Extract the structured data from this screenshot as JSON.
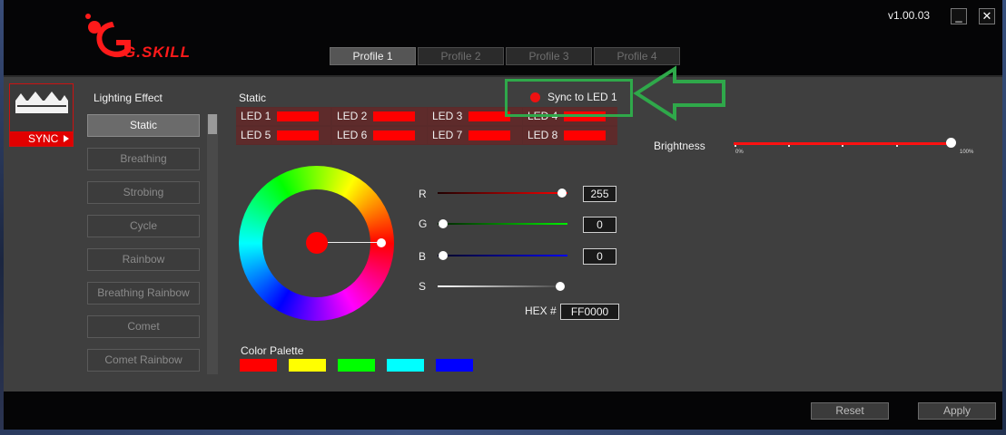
{
  "app": {
    "logo_text": "G.SKILL",
    "version": "v1.00.03",
    "minimize_glyph": "_",
    "close_glyph": "✕"
  },
  "profiles": [
    {
      "label": "Profile 1",
      "active": true
    },
    {
      "label": "Profile 2",
      "active": false
    },
    {
      "label": "Profile 3",
      "active": false
    },
    {
      "label": "Profile 4",
      "active": false
    }
  ],
  "module": {
    "sync_label": "SYNC"
  },
  "lighting": {
    "title": "Lighting Effect",
    "effects": [
      "Static",
      "Breathing",
      "Strobing",
      "Cycle",
      "Rainbow",
      "Breathing Rainbow",
      "Comet",
      "Comet Rainbow"
    ],
    "selected": "Static"
  },
  "static_panel": {
    "title": "Static",
    "leds": [
      "LED 1",
      "LED 2",
      "LED 3",
      "LED 4",
      "LED 5",
      "LED 6",
      "LED 7",
      "LED 8"
    ],
    "led_color": "#ff0000",
    "sync_text": "Sync to LED 1",
    "sync_dot_color": "#ee1111"
  },
  "brightness": {
    "label": "Brightness",
    "min_label": "0%",
    "max_label": "100%",
    "value_percent": 100
  },
  "color": {
    "r_label": "R",
    "g_label": "G",
    "b_label": "B",
    "s_label": "S",
    "r": "255",
    "g": "0",
    "b": "0",
    "hex_label": "HEX #",
    "hex": "FF0000"
  },
  "palette": {
    "label": "Color Palette",
    "colors": [
      "#ff0000",
      "#ffff00",
      "#00ff00",
      "#00ffff",
      "#0000ff"
    ]
  },
  "annotation": {
    "color": "#2fa84a"
  },
  "footer": {
    "reset_label": "Reset",
    "apply_label": "Apply"
  }
}
